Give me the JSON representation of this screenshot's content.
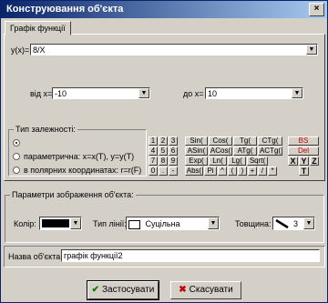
{
  "window": {
    "title": "Конструювання об'єкта",
    "close_glyph": "×"
  },
  "tab": {
    "label": "Графік функції"
  },
  "function": {
    "label": "y(x)=",
    "value": "8/X"
  },
  "range": {
    "from_label": "від x=",
    "from_value": "-10",
    "to_label": "до x=",
    "to_value": "10"
  },
  "dependency": {
    "legend": "Тип залежності:",
    "options": [
      {
        "label": "",
        "selected": true
      },
      {
        "label": "параметрична: x=x(T), y=y(T)",
        "selected": false
      },
      {
        "label": "в полярних координатах: r=r(F)",
        "selected": false
      }
    ]
  },
  "keypad": {
    "digits": [
      "1",
      "2",
      "3",
      "4",
      "5",
      "6",
      "7",
      "8",
      "9",
      "0",
      ".",
      "-"
    ],
    "functions": [
      "Sin(",
      "Cos(",
      "Tg(",
      "CTg(",
      "ASin(",
      "ACos(",
      "ATg(",
      "ACTg(",
      "Exp(",
      "Ln(",
      "Lg(",
      "Sqrt(",
      "Abs(",
      "Pi",
      "^",
      "(",
      ")",
      "+",
      "/",
      "*"
    ],
    "bs": "BS",
    "del": "Del",
    "vars": [
      "X",
      "Y",
      "Z"
    ],
    "t": "T"
  },
  "display": {
    "legend": "Параметри зображення об'єкта:",
    "color_label": "Колір:",
    "color_value": "#000000",
    "line_type_label": "Тип лінії:",
    "line_type_value": "Суцільна",
    "thickness_label": "Товщина:",
    "thickness_value": "3"
  },
  "name": {
    "label": "Назва об'єкта:",
    "value": "графік функції2"
  },
  "buttons": {
    "apply": "Застосувати",
    "cancel": "Скасувати"
  }
}
